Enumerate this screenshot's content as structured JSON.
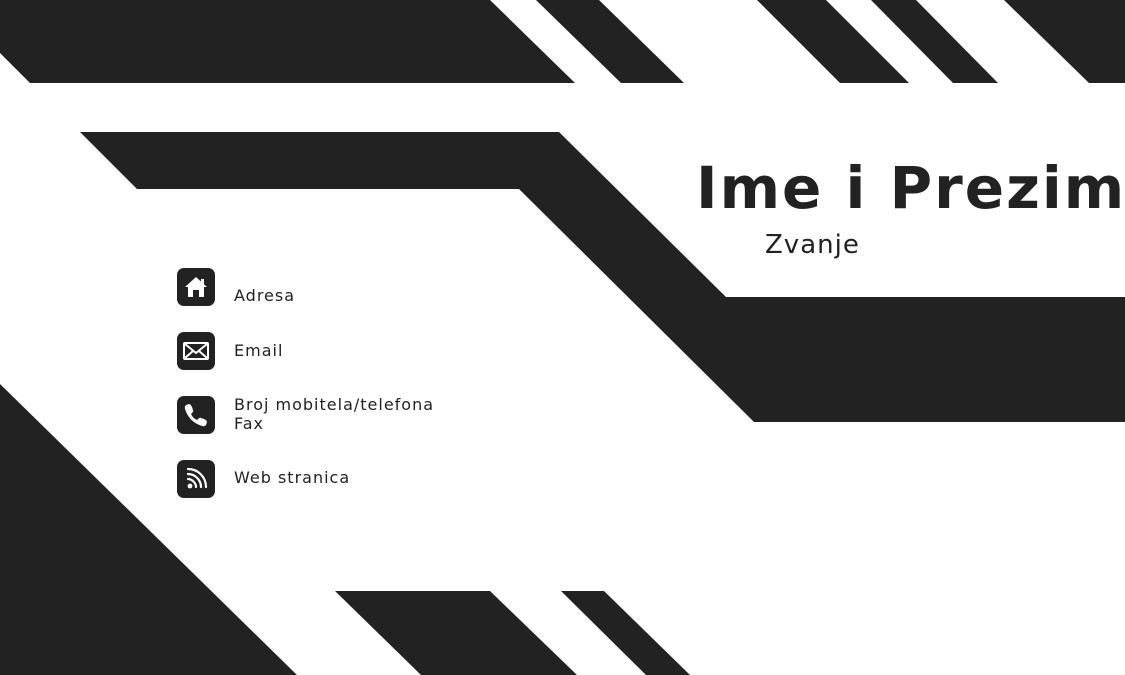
{
  "card": {
    "name": "Ime i Prezime",
    "title": "Zvanje",
    "contacts": {
      "address": "Adresa",
      "email": "Email",
      "phone": "Broj mobitela/telefona",
      "fax": "Fax",
      "website": "Web stranica"
    }
  },
  "icons": {
    "address": "home-icon",
    "email": "envelope-icon",
    "phone": "phone-icon",
    "website": "rss-icon"
  },
  "colors": {
    "background": "#ffffff",
    "dark": "#222222",
    "icon_foreground": "#ffffff"
  }
}
